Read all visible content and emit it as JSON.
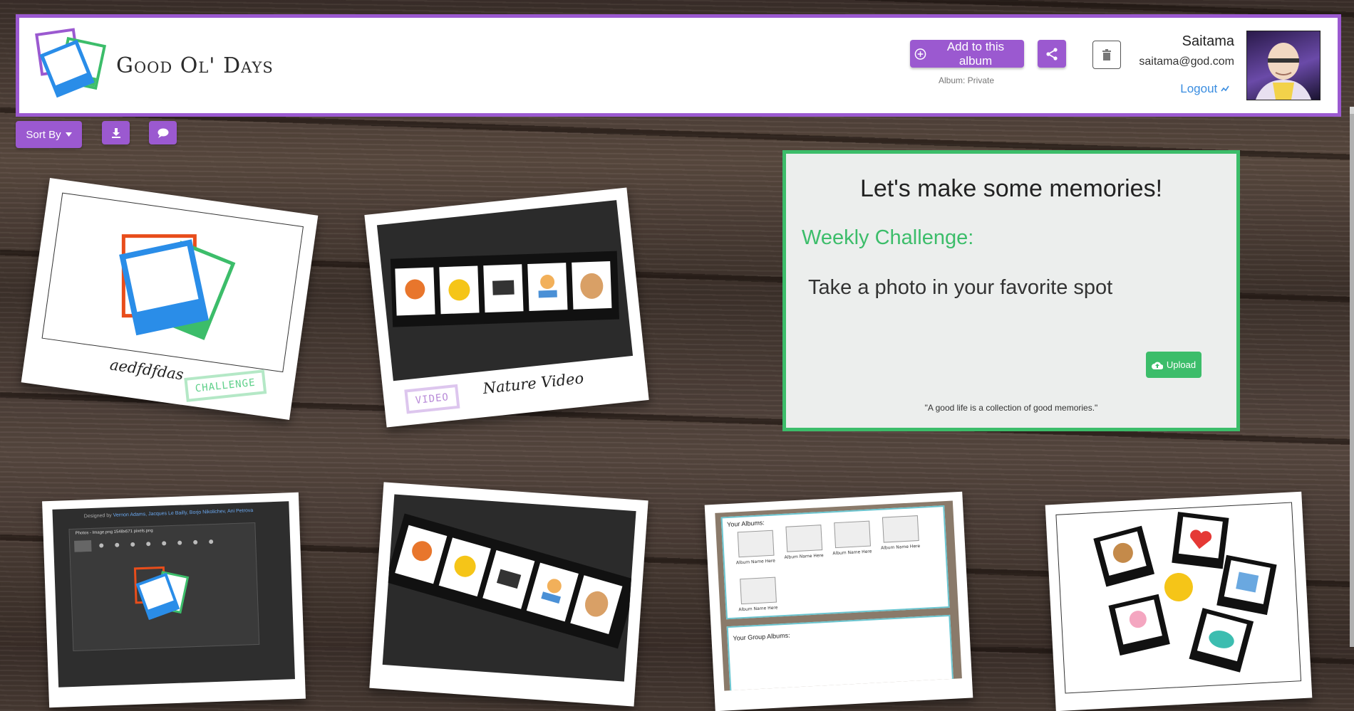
{
  "header": {
    "brand": "Good Ol' Days",
    "add_button_label": "Add to this album",
    "album_status": "Album: Private",
    "user_name": "Saitama",
    "user_email": "saitama@god.com",
    "logout_label": "Logout"
  },
  "toolbar": {
    "sort_label": "Sort By"
  },
  "photos": [
    {
      "caption": "aedfdfdas",
      "stamp": "CHALLENGE"
    },
    {
      "caption": "Nature Video",
      "stamp": "VIDEO"
    }
  ],
  "challenge": {
    "title": "Let's make some memories!",
    "label": "Weekly Challenge:",
    "text": "Take a photo in your favorite spot",
    "upload_label": "Upload",
    "quote": "\"A good life is a collection of good memories.\""
  },
  "screenshot_text": {
    "designed_by_prefix": "Designed by",
    "designers": "Vernon Adams, Jacques Le Bailly, Borjo Nikolichev, Ani Petrova",
    "window_title": "Photos - Image.png 1548x671 pixels.png",
    "your_albums": "Your Albums:",
    "album_name": "Album Name Here",
    "your_group_albums": "Your Group Albums:"
  },
  "colors": {
    "accent": "#9b59d0",
    "challenge_green": "#3cbd6a",
    "link_blue": "#3a8de0"
  }
}
